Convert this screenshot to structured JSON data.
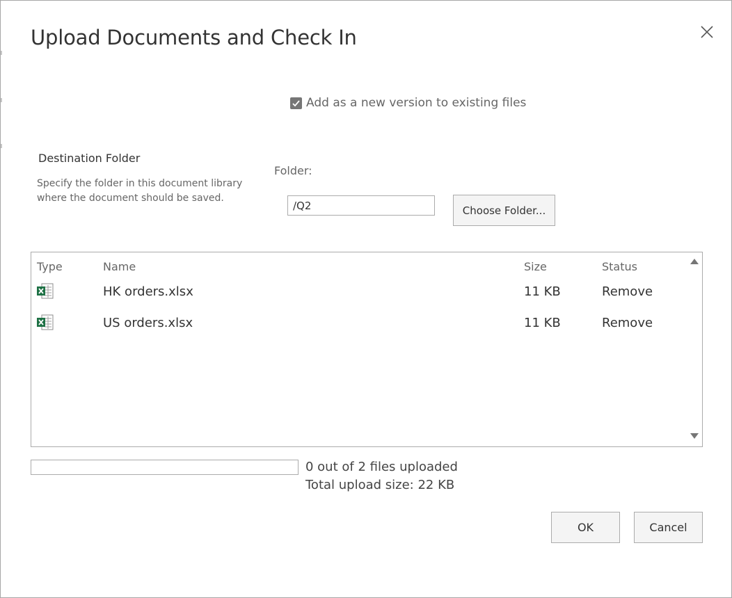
{
  "dialog": {
    "title": "Upload Documents and Check In",
    "close_icon": "close-icon"
  },
  "options": {
    "add_version_label": "Add as a new version to existing files",
    "add_version_checked": true
  },
  "destination": {
    "title": "Destination Folder",
    "description": "Specify the folder in this document library where the document should be saved.",
    "folder_label": "Folder:",
    "folder_value": "/Q2",
    "choose_button_label": "Choose Folder..."
  },
  "files": {
    "headers": {
      "type": "Type",
      "name": "Name",
      "size": "Size",
      "status": "Status"
    },
    "rows": [
      {
        "icon": "excel-file-icon",
        "name": "HK orders.xlsx",
        "size": "11 KB",
        "action": "Remove"
      },
      {
        "icon": "excel-file-icon",
        "name": "US orders.xlsx",
        "size": "11 KB",
        "action": "Remove"
      }
    ]
  },
  "upload": {
    "progress_fraction": 0,
    "status_text": "0 out of 2 files uploaded",
    "total_size_text": "Total upload size: 22 KB"
  },
  "buttons": {
    "ok_label": "OK",
    "cancel_label": "Cancel"
  },
  "colors": {
    "accent": "#0078d4",
    "excel_green": "#1e7145",
    "checkbox_bg": "#767676"
  }
}
